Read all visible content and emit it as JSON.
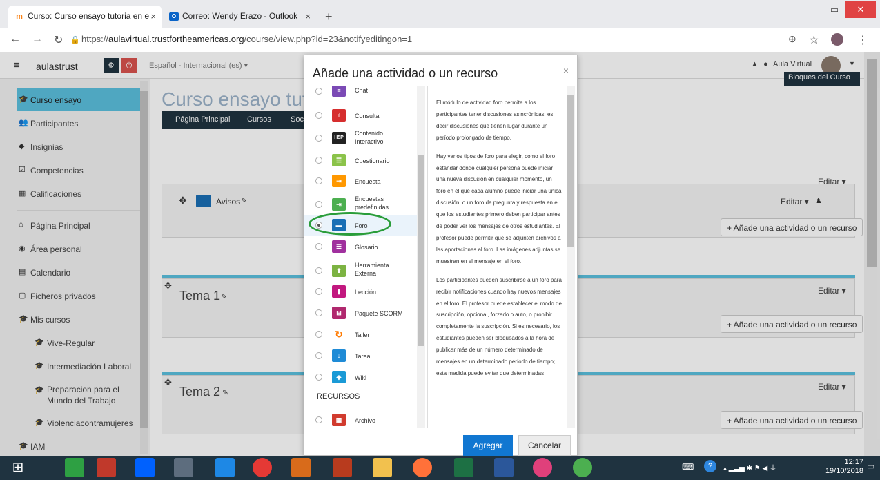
{
  "browser": {
    "tabs": [
      {
        "label": "Curso: Curso ensayo tutoria en e"
      },
      {
        "label": "Correo: Wendy Erazo - Outlook"
      }
    ],
    "url_prefix": "https://",
    "url_host": "aulavirtual.trustfortheamericas.org",
    "url_path": "/course/view.php?id=23&notifyeditingon=1"
  },
  "moodle": {
    "site_name": "aulastrust",
    "language": "Español - Internacional (es) ▾",
    "user": "Aula Virtual",
    "course_title": "Curso ensayo tuto",
    "breadcrumb": [
      "Página Principal",
      "Cursos",
      "Soc"
    ],
    "blocks_button": "Bloques del Curso"
  },
  "sidebar": {
    "items": [
      {
        "label": "Curso ensayo",
        "icon": "🎓"
      },
      {
        "label": "Participantes",
        "icon": "👥"
      },
      {
        "label": "Insignias",
        "icon": "◆"
      },
      {
        "label": "Competencias",
        "icon": "☑"
      },
      {
        "label": "Calificaciones",
        "icon": "▦"
      },
      {
        "label": "Página Principal",
        "icon": "⌂"
      },
      {
        "label": "Área personal",
        "icon": "◉"
      },
      {
        "label": "Calendario",
        "icon": "▤"
      },
      {
        "label": "Ficheros privados",
        "icon": "▢"
      },
      {
        "label": "Mis cursos",
        "icon": "🎓"
      },
      {
        "label": "Vive-Regular",
        "icon": "🎓"
      },
      {
        "label": "Intermediación Laboral",
        "icon": "🎓"
      },
      {
        "label": "Preparacion para el Mundo del Trabajo",
        "icon": "🎓"
      },
      {
        "label": "Violenciacontramujeres",
        "icon": "🎓"
      },
      {
        "label": "IAM",
        "icon": "🎓"
      }
    ]
  },
  "course": {
    "edit": "Editar ▾",
    "edit2": "Editar ▾",
    "avisos": "Avisos",
    "add_activity": "+ Añade una actividad o un recurso",
    "tema1": "Tema 1",
    "tema2": "Tema 2"
  },
  "modal": {
    "title": "Añade una actividad o un recurso",
    "close": "×",
    "items": [
      {
        "label": "Chat",
        "color": "#7b4ab5",
        "icon": "≡"
      },
      {
        "label": "Consulta",
        "color": "#d62e2e",
        "icon": "ıl"
      },
      {
        "label": "Contenido Interactivo",
        "color": "#222222",
        "icon": "H5P"
      },
      {
        "label": "Cuestionario",
        "color": "#8bc34a",
        "icon": "☰"
      },
      {
        "label": "Encuesta",
        "color": "#ff9800",
        "icon": "⇥"
      },
      {
        "label": "Encuestas predefinidas",
        "color": "#4caf50",
        "icon": "⇥"
      },
      {
        "label": "Foro",
        "color": "#1a6fb5",
        "icon": "▬"
      },
      {
        "label": "Glosario",
        "color": "#a0309e",
        "icon": "☰"
      },
      {
        "label": "Herramienta Externa",
        "color": "#7cb342",
        "icon": "⬆"
      },
      {
        "label": "Lección",
        "color": "#c2187f",
        "icon": "▮"
      },
      {
        "label": "Paquete SCORM",
        "color": "#b0286e",
        "icon": "⊟"
      },
      {
        "label": "Taller",
        "color": "#ff7a00",
        "icon": "↻"
      },
      {
        "label": "Tarea",
        "color": "#1f8bd6",
        "icon": "↓"
      },
      {
        "label": "Wiki",
        "color": "#1a9ad6",
        "icon": "◆"
      }
    ],
    "resources_heading": "RECURSOS",
    "resource_items": [
      {
        "label": "Archivo",
        "color": "#d13b2e",
        "icon": "▦"
      }
    ],
    "description": [
      "El módulo de actividad foro permite a los participantes tener discusiones asincrónicas, es decir discusiones que tienen lugar durante un período prolongado de tiempo.",
      "Hay varios tipos de foro para elegir, como el foro estándar donde cualquier persona puede iniciar una nueva discusión en cualquier momento, un foro en el que cada alumno puede iniciar una única discusión, o un foro de pregunta y respuesta en el que los estudiantes primero deben participar antes de poder ver los mensajes de otros estudiantes. El profesor puede permitir que se adjunten archivos a las aportaciones al foro. Las imágenes adjuntas se muestran en el mensaje en el foro.",
      "Los participantes pueden suscribirse a un foro para recibir notificaciones cuando hay nuevos mensajes en el foro. El profesor puede establecer el modo de suscripción, opcional, forzado o auto, o prohibir completamente la suscripción. Si es necesario, los estudiantes pueden ser bloqueados a la hora de publicar más de un número determinado de mensajes en un determinado período de tiempo; esta medida puede evitar que determinadas"
    ],
    "add_button": "Agregar",
    "cancel_button": "Cancelar"
  },
  "taskbar": {
    "time": "12:17",
    "date": "19/10/2018"
  }
}
